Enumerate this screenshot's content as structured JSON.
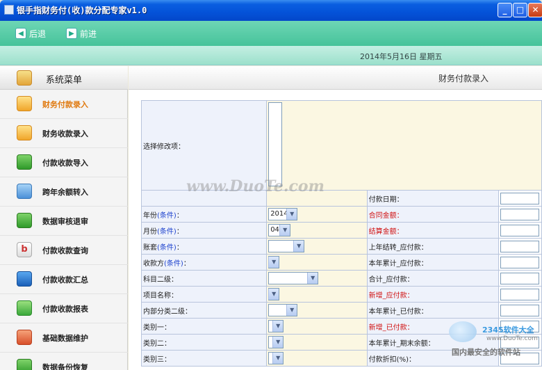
{
  "window": {
    "title": "银手指财务付(收)款分配专家v1.0",
    "minimize": "_",
    "maximize": "□",
    "close": "✕"
  },
  "toolbar": {
    "back_label": "后退",
    "forward_label": "前进",
    "back_icon": "arrow-left-icon",
    "forward_icon": "arrow-right-icon",
    "date": "2014年5月16日  星期五"
  },
  "sidebar": {
    "title": "系统菜单",
    "items": [
      {
        "label": "财务付款录入",
        "icon": "star-icon",
        "active": true
      },
      {
        "label": "财务收款录入",
        "icon": "star-icon"
      },
      {
        "label": "付款收款导入",
        "icon": "chat-bubble-icon"
      },
      {
        "label": "跨年余额转入",
        "icon": "cloud-icon"
      },
      {
        "label": "数据审核退审",
        "icon": "basket-icon"
      },
      {
        "label": "付款收款查询",
        "icon": "b-icon"
      },
      {
        "label": "付款收款汇总",
        "icon": "magnifier-icon"
      },
      {
        "label": "付款收款报表",
        "icon": "refresh-icon"
      },
      {
        "label": "基础数据维护",
        "icon": "gift-icon"
      },
      {
        "label": "数据备份恢复",
        "icon": "share-icon"
      }
    ]
  },
  "main": {
    "title": "财务付款录入",
    "select_label": "选择修改项：",
    "rows": [
      {
        "l1": "",
        "v1": "",
        "l2": "付款日期："
      },
      {
        "l1": "年份",
        "c1": "(条件)",
        "colon": "：",
        "v1": "2014",
        "l2": "合同金额：",
        "red": true
      },
      {
        "l1": "月份",
        "c1": "(条件)",
        "colon": "：",
        "v1": "04",
        "l2": "结算金额：",
        "red": true
      },
      {
        "l1": "账套",
        "c1": "(条件)",
        "colon": "：",
        "v1": "",
        "l2": "上年结转_应付款："
      },
      {
        "l1": "收款方",
        "c1": "(条件)",
        "colon": "：",
        "v1": "",
        "l2": "本年累计_应付款："
      },
      {
        "l1": "科目二级：",
        "v1": "",
        "l2": "合计_应付款："
      },
      {
        "l1": "项目名称：",
        "v1": "",
        "l2": "新增_应付款：",
        "red": true
      },
      {
        "l1": "内部分类二级：",
        "v1": "",
        "l2": "本年累计_已付款："
      },
      {
        "l1": "类别一：",
        "v1": "",
        "l2": "新增_已付款：",
        "red": true
      },
      {
        "l1": "类别二：",
        "v1": "",
        "l2": "本年累计_期末余额："
      },
      {
        "l1": "类别三：",
        "v1": "",
        "l2": "付款折扣(%)："
      }
    ]
  },
  "watermark": {
    "text": "www.DuoTe.com",
    "brand": "2345软件大全",
    "url": "www.DuoTe.com",
    "tagline": "国内最安全的软件站"
  }
}
